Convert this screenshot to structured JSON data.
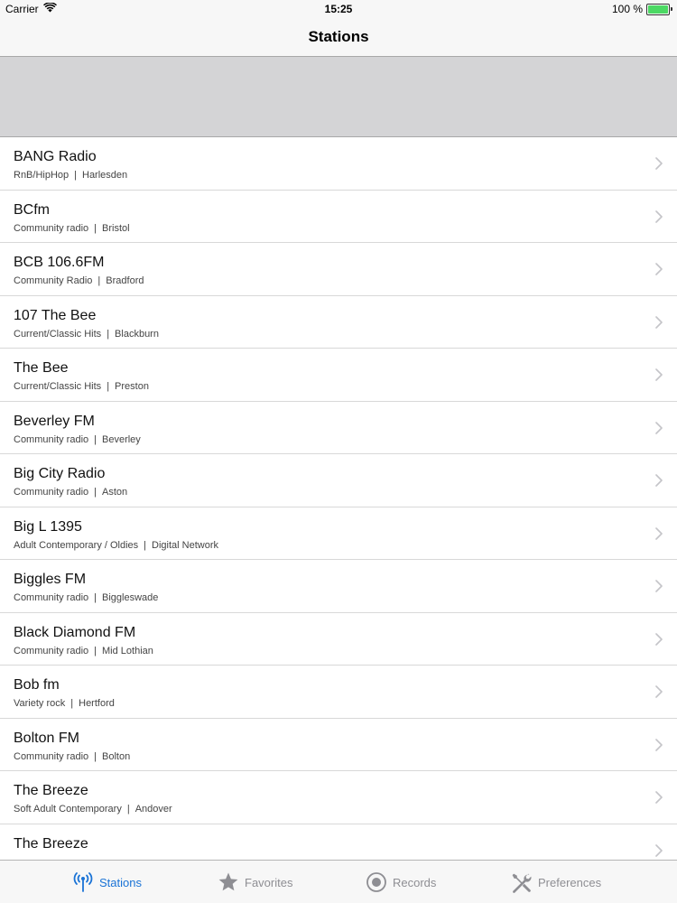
{
  "status_bar": {
    "carrier": "Carrier",
    "time": "15:25",
    "battery": "100 %",
    "battery_level": 1.0
  },
  "nav": {
    "title": "Stations"
  },
  "stations": [
    {
      "name": "BANG Radio",
      "genre": "RnB/HipHop",
      "location": "Harlesden"
    },
    {
      "name": "BCfm",
      "genre": "Community radio",
      "location": "Bristol"
    },
    {
      "name": "BCB 106.6FM",
      "genre": "Community Radio",
      "location": "Bradford"
    },
    {
      "name": "107 The Bee",
      "genre": "Current/Classic Hits",
      "location": "Blackburn"
    },
    {
      "name": "The Bee",
      "genre": "Current/Classic Hits",
      "location": "Preston"
    },
    {
      "name": "Beverley FM",
      "genre": "Community radio",
      "location": "Beverley"
    },
    {
      "name": "Big City Radio",
      "genre": "Community radio",
      "location": "Aston"
    },
    {
      "name": "Big L 1395",
      "genre": "Adult Contemporary / Oldies",
      "location": "Digital Network"
    },
    {
      "name": "Biggles FM",
      "genre": "Community radio",
      "location": "Biggleswade"
    },
    {
      "name": "Black Diamond FM",
      "genre": "Community radio",
      "location": "Mid Lothian"
    },
    {
      "name": "Bob fm",
      "genre": "Variety rock",
      "location": "Hertford"
    },
    {
      "name": "Bolton FM",
      "genre": "Community radio",
      "location": "Bolton"
    },
    {
      "name": "The Breeze",
      "genre": "Soft Adult Contemporary",
      "location": "Andover"
    },
    {
      "name": "The Breeze",
      "genre": "",
      "location": ""
    }
  ],
  "separator": "|",
  "tabs": [
    {
      "label": "Stations",
      "icon": "antenna-icon",
      "active": true
    },
    {
      "label": "Favorites",
      "icon": "star-icon",
      "active": false
    },
    {
      "label": "Records",
      "icon": "record-icon",
      "active": false
    },
    {
      "label": "Preferences",
      "icon": "tools-icon",
      "active": false
    }
  ],
  "colors": {
    "accent": "#1a73d6",
    "tab_inactive": "#8e8e93",
    "banner": "#d4d4d6",
    "battery": "#4cd964"
  }
}
